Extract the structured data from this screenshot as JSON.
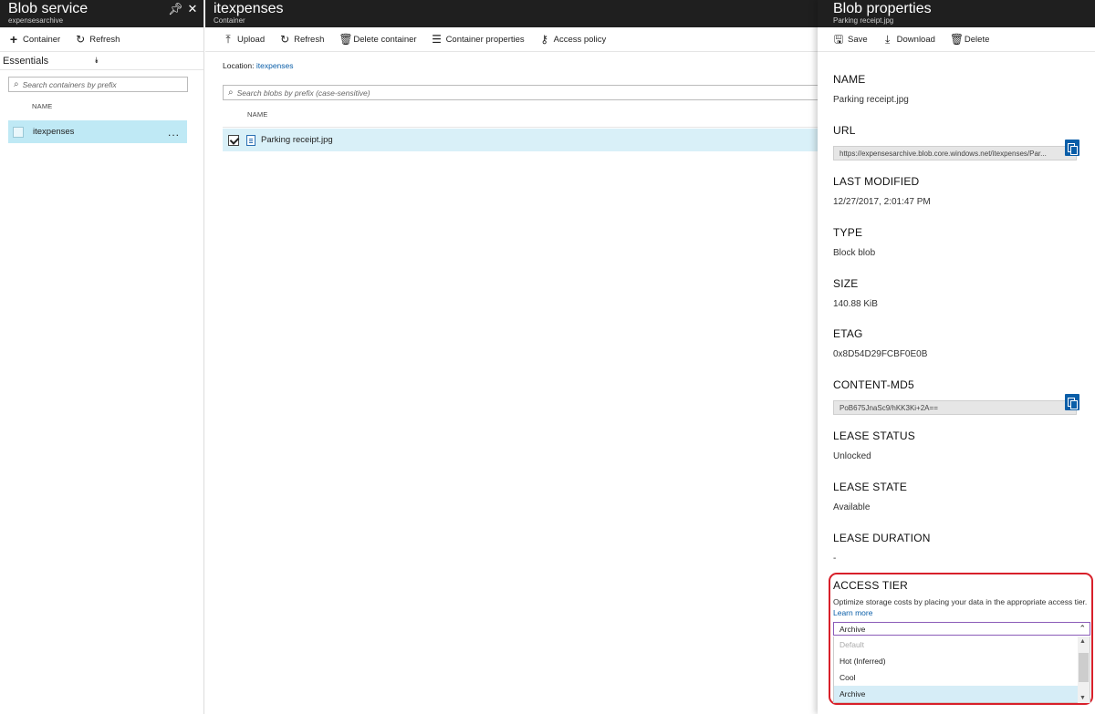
{
  "blob_service": {
    "title": "Blob service",
    "subtitle": "expensesarchive",
    "toolbar": {
      "container": "Container",
      "refresh": "Refresh"
    },
    "essentials": "Essentials",
    "search_placeholder": "Search containers by prefix",
    "col_name": "NAME",
    "rows": [
      {
        "name": "itexpenses",
        "more": "..."
      }
    ]
  },
  "container": {
    "title": "itexpenses",
    "subtitle": "Container",
    "toolbar": {
      "upload": "Upload",
      "refresh": "Refresh",
      "delete_container": "Delete container",
      "container_properties": "Container properties",
      "access_policy": "Access policy"
    },
    "location_label": "Location:",
    "location_link": "itexpenses",
    "search_placeholder": "Search blobs by prefix (case-sensitive)",
    "col_name": "NAME",
    "rows": [
      {
        "name": "Parking receipt.jpg"
      }
    ]
  },
  "props": {
    "title": "Blob properties",
    "subtitle": "Parking receipt.jpg",
    "toolbar": {
      "save": "Save",
      "download": "Download",
      "delete": "Delete"
    },
    "name_label": "NAME",
    "name_value": "Parking receipt.jpg",
    "url_label": "URL",
    "url_value": "https://expensesarchive.blob.core.windows.net/itexpenses/Par...",
    "last_modified_label": "LAST MODIFIED",
    "last_modified_value": "12/27/2017, 2:01:47 PM",
    "type_label": "TYPE",
    "type_value": "Block blob",
    "size_label": "SIZE",
    "size_value": "140.88 KiB",
    "etag_label": "ETAG",
    "etag_value": "0x8D54D29FCBF0E0B",
    "md5_label": "CONTENT-MD5",
    "md5_value": "PoB675JnaSc9/hKK3Ki+2A==",
    "lease_status_label": "LEASE STATUS",
    "lease_status_value": "Unlocked",
    "lease_state_label": "LEASE STATE",
    "lease_state_value": "Available",
    "lease_duration_label": "LEASE DURATION",
    "lease_duration_value": "-",
    "access_tier_label": "ACCESS TIER",
    "access_tier_desc": "Optimize storage costs by placing your data in the appropriate access tier.",
    "learn_more": "Learn more",
    "access_tier_selected": "Archive",
    "access_tier_options": [
      "Default",
      "Hot (Inferred)",
      "Cool",
      "Archive"
    ]
  }
}
